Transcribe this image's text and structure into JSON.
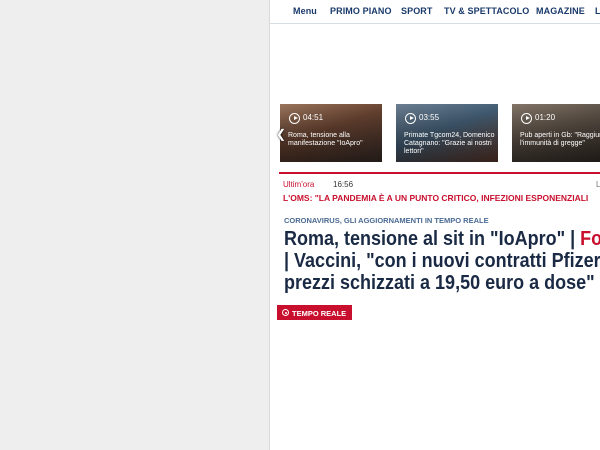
{
  "nav": {
    "items": [
      "Menu",
      "PRIMO PIANO",
      "SPORT",
      "TV & SPETTACOLO",
      "MAGAZINE",
      "L"
    ]
  },
  "video_strip": {
    "cards": [
      {
        "duration": "04:51",
        "caption": "Roma, tensione alla manifestazione \"IoApro\""
      },
      {
        "duration": "03:55",
        "caption": "Primate Tgcom24, Domenico Catagnano: \"Grazie ai nostri lettori\""
      },
      {
        "duration": "01:20",
        "caption": "Pub aperti in Gb: \"Raggiunta l'immunità di gregge\""
      }
    ],
    "colors": [
      "#8a6a58",
      "#4f6f8a",
      "#6b5e52"
    ]
  },
  "ticker": {
    "label": "Ultim'ora",
    "time": "16:56",
    "more": "L",
    "headline": "L'OMS: \"LA PANDEMIA È A UN PUNTO CRITICO, INFEZIONI ESPONENZIALI"
  },
  "article": {
    "kicker": "CORONAVIRUS, GLI AGGIORNAMENTI IN TEMPO REALE",
    "headline_line1": "Roma, tensione al sit in \"IoApro\" | ",
    "headline_line1_link": "Fot",
    "headline_line2": "| Vaccini, \"con i nuovi contratti Pfizer",
    "headline_line3": "prezzi schizzati a 19,50 euro a dose\""
  },
  "live_badge": {
    "label": "TEMPO REALE"
  },
  "colors": {
    "brand_red": "#c8102e",
    "nav_blue": "#1a3a6b",
    "headline": "#1a2a44"
  }
}
